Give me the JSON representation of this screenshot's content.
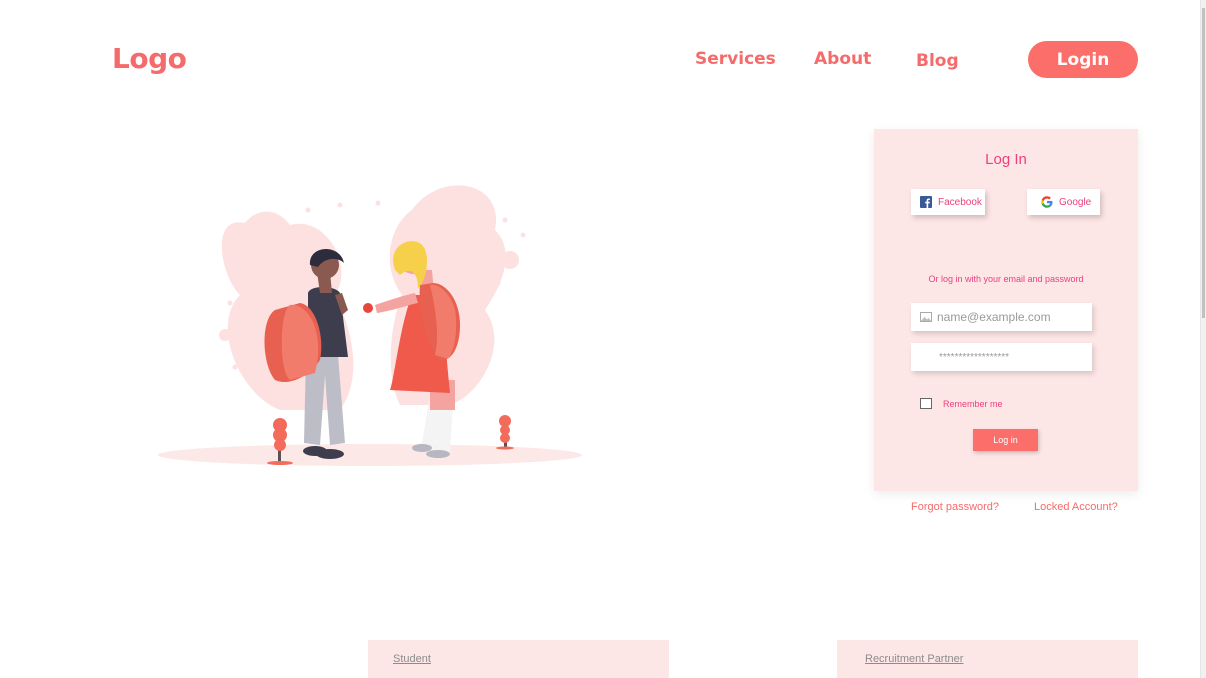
{
  "header": {
    "logo": "Logo",
    "nav": {
      "services": "Services",
      "about": "About",
      "blog": "Blog"
    },
    "login_button": "Login"
  },
  "login_card": {
    "title": "Log In",
    "facebook_label": "Facebook",
    "google_label": "Google",
    "or_text": "Or log in with your email and password",
    "email_placeholder": "name@example.com",
    "password_value": "******************",
    "remember_label": "Remember me",
    "submit_label": "Log in"
  },
  "links": {
    "forgot": "Forgot password?",
    "locked": "Locked Account?"
  },
  "bottom_tabs": {
    "student": "Student",
    "recruitment": "Recruitment Partner"
  },
  "colors": {
    "accent": "#fb6e6a",
    "pink_text": "#ec3f7f",
    "card_bg": "#fde6e6"
  },
  "icons": [
    "facebook-icon",
    "google-icon",
    "image-icon",
    "checkbox"
  ]
}
